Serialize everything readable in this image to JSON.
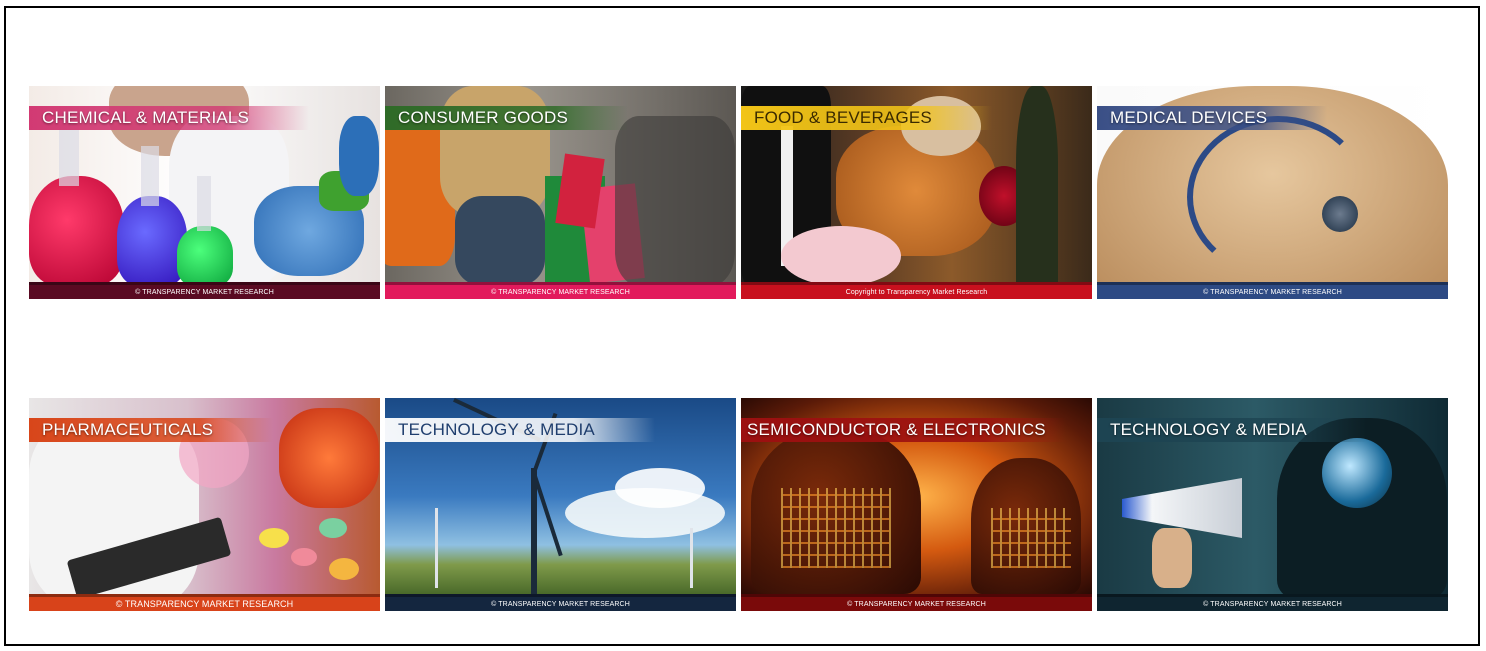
{
  "tiles": [
    {
      "title": "CHEMICAL & MATERIALS",
      "footer": "© TRANSPARENCY MARKET RESEARCH",
      "banner_color": "#d23a73",
      "footer_color": "#5a0a22"
    },
    {
      "title": "CONSUMER GOODS",
      "footer": "© TRANSPARENCY MARKET RESEARCH",
      "banner_color": "#2f6b28",
      "footer_color": "#e21a5c"
    },
    {
      "title": "FOOD & BEVERAGES",
      "footer": "Copyright to Transparency Market Research",
      "banner_color": "#f2c417",
      "footer_color": "#c8101e"
    },
    {
      "title": "MEDICAL DEVICES",
      "footer": "© TRANSPARENCY MARKET RESEARCH",
      "banner_color": "#3a4f86",
      "footer_color": "#2d4a84"
    },
    {
      "title": "PHARMACEUTICALS",
      "footer": "© TRANSPARENCY MARKET RESEARCH",
      "banner_color": "#d8461a",
      "footer_color": "#d8431a"
    },
    {
      "title": "TECHNOLOGY & MEDIA",
      "footer": "© TRANSPARENCY MARKET RESEARCH",
      "banner_color": "#1f3e6e",
      "footer_color": "#14263f"
    },
    {
      "title": "SEMICONDUCTOR & ELECTRONICS",
      "footer": "© TRANSPARENCY MARKET RESEARCH",
      "banner_color": "#9c1010",
      "footer_color": "#7a0a0a"
    },
    {
      "title": "TECHNOLOGY & MEDIA",
      "footer": "© TRANSPARENCY MARKET RESEARCH",
      "banner_color": "#1d4452",
      "footer_color": "#0f2530"
    }
  ]
}
